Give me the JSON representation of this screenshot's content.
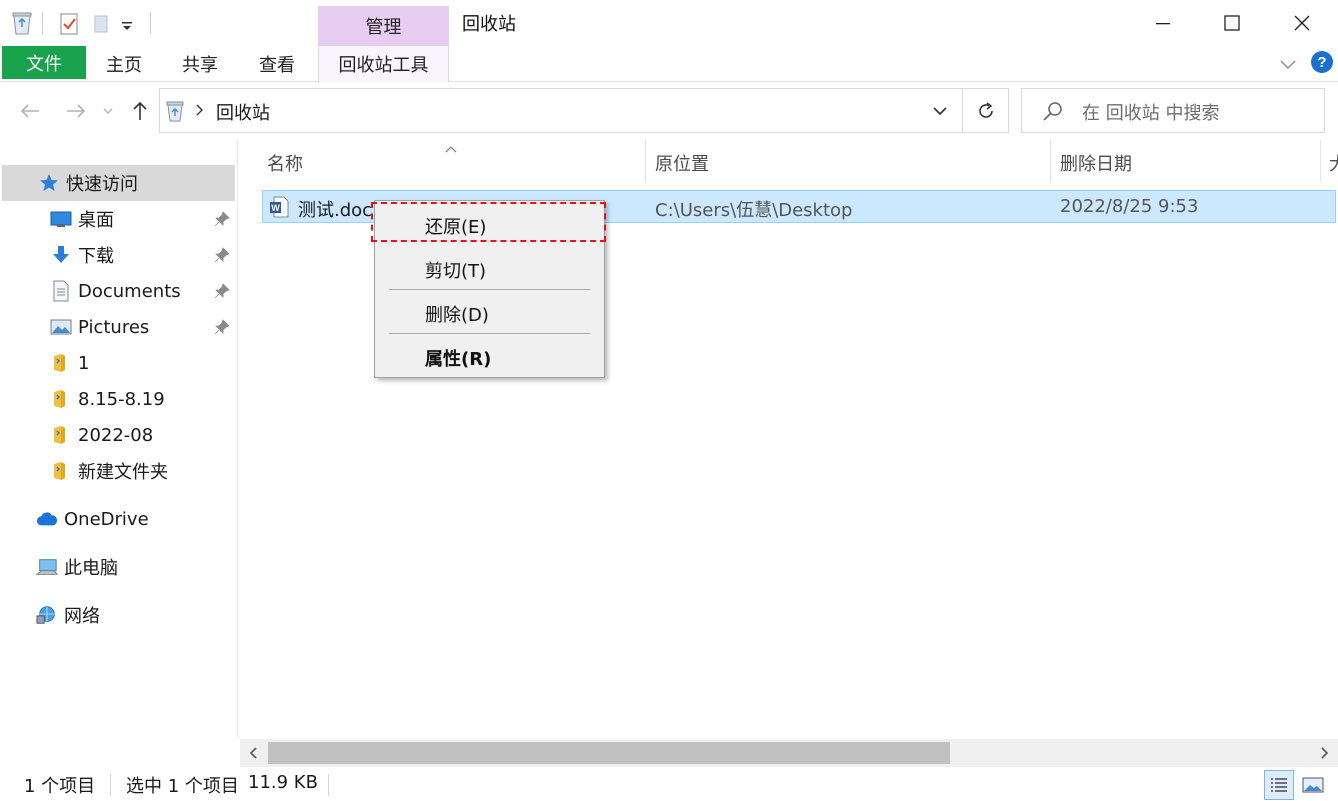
{
  "window": {
    "title": "回收站",
    "context_tab": "管理",
    "colors": {
      "file_tab": "#19a24c",
      "context_tab": "#e8cdf3",
      "selection": "#cce8ff",
      "highlight_border": "#e0141c"
    }
  },
  "ribbon": {
    "tabs": [
      "文件",
      "主页",
      "共享",
      "查看",
      "回收站工具"
    ]
  },
  "address": {
    "path": "回收站",
    "search_placeholder": "在 回收站 中搜索"
  },
  "sidebar": {
    "quick_access": "快速访问",
    "items": [
      {
        "label": "桌面",
        "icon": "desktop-icon",
        "pinned": true
      },
      {
        "label": "下载",
        "icon": "download-icon",
        "pinned": true
      },
      {
        "label": "Documents",
        "icon": "document-icon",
        "pinned": true
      },
      {
        "label": "Pictures",
        "icon": "pictures-icon",
        "pinned": true
      },
      {
        "label": "1",
        "icon": "folder-icon",
        "pinned": false
      },
      {
        "label": "8.15-8.19",
        "icon": "folder-icon",
        "pinned": false
      },
      {
        "label": "2022-08",
        "icon": "folder-icon",
        "pinned": false
      },
      {
        "label": "新建文件夹",
        "icon": "folder-icon",
        "pinned": false
      }
    ],
    "onedrive": "OneDrive",
    "this_pc": "此电脑",
    "network": "网络"
  },
  "columns": [
    "名称",
    "原位置",
    "删除日期",
    "大"
  ],
  "files": [
    {
      "name": "测试.docx",
      "name_visible": "测试.doc",
      "location": "C:\\Users\\伍慧\\Desktop",
      "deleted": "2022/8/25 9:53",
      "icon": "word-doc-icon"
    }
  ],
  "context_menu": {
    "items": [
      "还原(E)",
      "剪切(T)",
      "删除(D)",
      "属性(R)"
    ],
    "highlighted": "还原(E)"
  },
  "status": {
    "count": "1 个项目",
    "selected": "选中 1 个项目",
    "size": "11.9 KB"
  }
}
